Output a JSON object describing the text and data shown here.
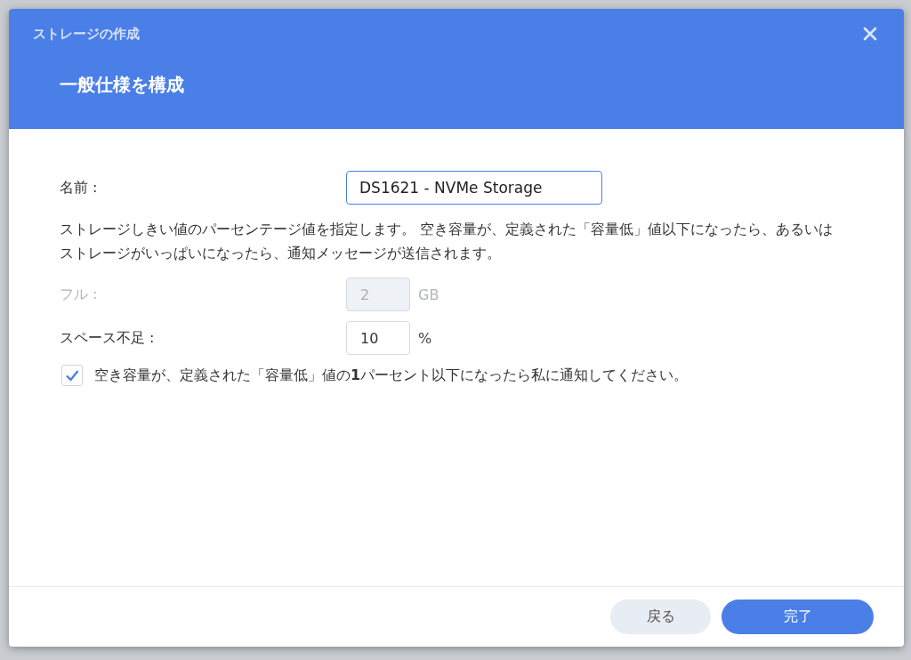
{
  "window": {
    "title": "ストレージの作成"
  },
  "heading": "一般仕様を構成",
  "name_field": {
    "label": "名前 :",
    "value": "DS1621 - NVMe Storage"
  },
  "description": "ストレージしきい値のパーセンテージ値を指定します。 空き容量が、定義された「容量低」値以下になったら、あるいはストレージがいっぱいになったら、通知メッセージが送信されます。",
  "thresholds": [
    {
      "label": "フル :",
      "value": "2",
      "unit": "GB",
      "disabled": true
    },
    {
      "label": "スペース不足 :",
      "value": "10",
      "unit": "%",
      "disabled": false
    }
  ],
  "notify": {
    "label": "空き容量が、定義された「容量低」値の**1**パーセント以下になったら私に通知してください。",
    "checked": true
  },
  "buttons": [
    {
      "label": "戻る",
      "kind": "secondary"
    },
    {
      "label": "完了",
      "kind": "primary"
    }
  ]
}
